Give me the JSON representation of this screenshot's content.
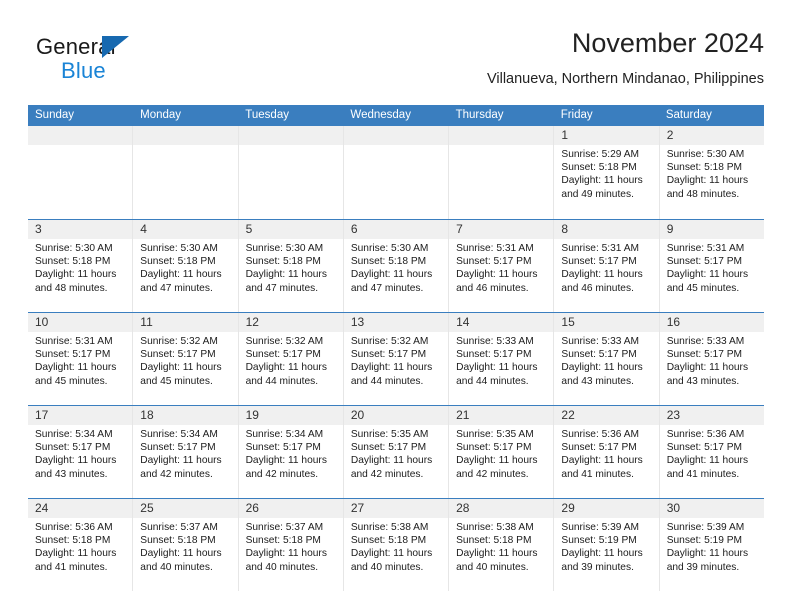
{
  "brand": {
    "name_top": "General",
    "name_bottom": "Blue",
    "triangle_color": "#1769b0",
    "blue_text_color": "#1a84d6"
  },
  "header": {
    "title": "November 2024",
    "subtitle": "Villanueva, Northern Mindanao, Philippines"
  },
  "theme": {
    "header_bar_color": "#3a7ebf",
    "day_band_color": "#f0f0f0",
    "week_separator_color": "#3a7ebf"
  },
  "weekdays": [
    "Sunday",
    "Monday",
    "Tuesday",
    "Wednesday",
    "Thursday",
    "Friday",
    "Saturday"
  ],
  "weeks": [
    [
      {
        "day": "",
        "empty": true,
        "sunrise": "",
        "sunset": "",
        "daylight": ""
      },
      {
        "day": "",
        "empty": true,
        "sunrise": "",
        "sunset": "",
        "daylight": ""
      },
      {
        "day": "",
        "empty": true,
        "sunrise": "",
        "sunset": "",
        "daylight": ""
      },
      {
        "day": "",
        "empty": true,
        "sunrise": "",
        "sunset": "",
        "daylight": ""
      },
      {
        "day": "",
        "empty": true,
        "sunrise": "",
        "sunset": "",
        "daylight": ""
      },
      {
        "day": "1",
        "empty": false,
        "sunrise": "Sunrise: 5:29 AM",
        "sunset": "Sunset: 5:18 PM",
        "daylight": "Daylight: 11 hours and 49 minutes."
      },
      {
        "day": "2",
        "empty": false,
        "sunrise": "Sunrise: 5:30 AM",
        "sunset": "Sunset: 5:18 PM",
        "daylight": "Daylight: 11 hours and 48 minutes."
      }
    ],
    [
      {
        "day": "3",
        "empty": false,
        "sunrise": "Sunrise: 5:30 AM",
        "sunset": "Sunset: 5:18 PM",
        "daylight": "Daylight: 11 hours and 48 minutes."
      },
      {
        "day": "4",
        "empty": false,
        "sunrise": "Sunrise: 5:30 AM",
        "sunset": "Sunset: 5:18 PM",
        "daylight": "Daylight: 11 hours and 47 minutes."
      },
      {
        "day": "5",
        "empty": false,
        "sunrise": "Sunrise: 5:30 AM",
        "sunset": "Sunset: 5:18 PM",
        "daylight": "Daylight: 11 hours and 47 minutes."
      },
      {
        "day": "6",
        "empty": false,
        "sunrise": "Sunrise: 5:30 AM",
        "sunset": "Sunset: 5:18 PM",
        "daylight": "Daylight: 11 hours and 47 minutes."
      },
      {
        "day": "7",
        "empty": false,
        "sunrise": "Sunrise: 5:31 AM",
        "sunset": "Sunset: 5:17 PM",
        "daylight": "Daylight: 11 hours and 46 minutes."
      },
      {
        "day": "8",
        "empty": false,
        "sunrise": "Sunrise: 5:31 AM",
        "sunset": "Sunset: 5:17 PM",
        "daylight": "Daylight: 11 hours and 46 minutes."
      },
      {
        "day": "9",
        "empty": false,
        "sunrise": "Sunrise: 5:31 AM",
        "sunset": "Sunset: 5:17 PM",
        "daylight": "Daylight: 11 hours and 45 minutes."
      }
    ],
    [
      {
        "day": "10",
        "empty": false,
        "sunrise": "Sunrise: 5:31 AM",
        "sunset": "Sunset: 5:17 PM",
        "daylight": "Daylight: 11 hours and 45 minutes."
      },
      {
        "day": "11",
        "empty": false,
        "sunrise": "Sunrise: 5:32 AM",
        "sunset": "Sunset: 5:17 PM",
        "daylight": "Daylight: 11 hours and 45 minutes."
      },
      {
        "day": "12",
        "empty": false,
        "sunrise": "Sunrise: 5:32 AM",
        "sunset": "Sunset: 5:17 PM",
        "daylight": "Daylight: 11 hours and 44 minutes."
      },
      {
        "day": "13",
        "empty": false,
        "sunrise": "Sunrise: 5:32 AM",
        "sunset": "Sunset: 5:17 PM",
        "daylight": "Daylight: 11 hours and 44 minutes."
      },
      {
        "day": "14",
        "empty": false,
        "sunrise": "Sunrise: 5:33 AM",
        "sunset": "Sunset: 5:17 PM",
        "daylight": "Daylight: 11 hours and 44 minutes."
      },
      {
        "day": "15",
        "empty": false,
        "sunrise": "Sunrise: 5:33 AM",
        "sunset": "Sunset: 5:17 PM",
        "daylight": "Daylight: 11 hours and 43 minutes."
      },
      {
        "day": "16",
        "empty": false,
        "sunrise": "Sunrise: 5:33 AM",
        "sunset": "Sunset: 5:17 PM",
        "daylight": "Daylight: 11 hours and 43 minutes."
      }
    ],
    [
      {
        "day": "17",
        "empty": false,
        "sunrise": "Sunrise: 5:34 AM",
        "sunset": "Sunset: 5:17 PM",
        "daylight": "Daylight: 11 hours and 43 minutes."
      },
      {
        "day": "18",
        "empty": false,
        "sunrise": "Sunrise: 5:34 AM",
        "sunset": "Sunset: 5:17 PM",
        "daylight": "Daylight: 11 hours and 42 minutes."
      },
      {
        "day": "19",
        "empty": false,
        "sunrise": "Sunrise: 5:34 AM",
        "sunset": "Sunset: 5:17 PM",
        "daylight": "Daylight: 11 hours and 42 minutes."
      },
      {
        "day": "20",
        "empty": false,
        "sunrise": "Sunrise: 5:35 AM",
        "sunset": "Sunset: 5:17 PM",
        "daylight": "Daylight: 11 hours and 42 minutes."
      },
      {
        "day": "21",
        "empty": false,
        "sunrise": "Sunrise: 5:35 AM",
        "sunset": "Sunset: 5:17 PM",
        "daylight": "Daylight: 11 hours and 42 minutes."
      },
      {
        "day": "22",
        "empty": false,
        "sunrise": "Sunrise: 5:36 AM",
        "sunset": "Sunset: 5:17 PM",
        "daylight": "Daylight: 11 hours and 41 minutes."
      },
      {
        "day": "23",
        "empty": false,
        "sunrise": "Sunrise: 5:36 AM",
        "sunset": "Sunset: 5:17 PM",
        "daylight": "Daylight: 11 hours and 41 minutes."
      }
    ],
    [
      {
        "day": "24",
        "empty": false,
        "sunrise": "Sunrise: 5:36 AM",
        "sunset": "Sunset: 5:18 PM",
        "daylight": "Daylight: 11 hours and 41 minutes."
      },
      {
        "day": "25",
        "empty": false,
        "sunrise": "Sunrise: 5:37 AM",
        "sunset": "Sunset: 5:18 PM",
        "daylight": "Daylight: 11 hours and 40 minutes."
      },
      {
        "day": "26",
        "empty": false,
        "sunrise": "Sunrise: 5:37 AM",
        "sunset": "Sunset: 5:18 PM",
        "daylight": "Daylight: 11 hours and 40 minutes."
      },
      {
        "day": "27",
        "empty": false,
        "sunrise": "Sunrise: 5:38 AM",
        "sunset": "Sunset: 5:18 PM",
        "daylight": "Daylight: 11 hours and 40 minutes."
      },
      {
        "day": "28",
        "empty": false,
        "sunrise": "Sunrise: 5:38 AM",
        "sunset": "Sunset: 5:18 PM",
        "daylight": "Daylight: 11 hours and 40 minutes."
      },
      {
        "day": "29",
        "empty": false,
        "sunrise": "Sunrise: 5:39 AM",
        "sunset": "Sunset: 5:19 PM",
        "daylight": "Daylight: 11 hours and 39 minutes."
      },
      {
        "day": "30",
        "empty": false,
        "sunrise": "Sunrise: 5:39 AM",
        "sunset": "Sunset: 5:19 PM",
        "daylight": "Daylight: 11 hours and 39 minutes."
      }
    ]
  ]
}
